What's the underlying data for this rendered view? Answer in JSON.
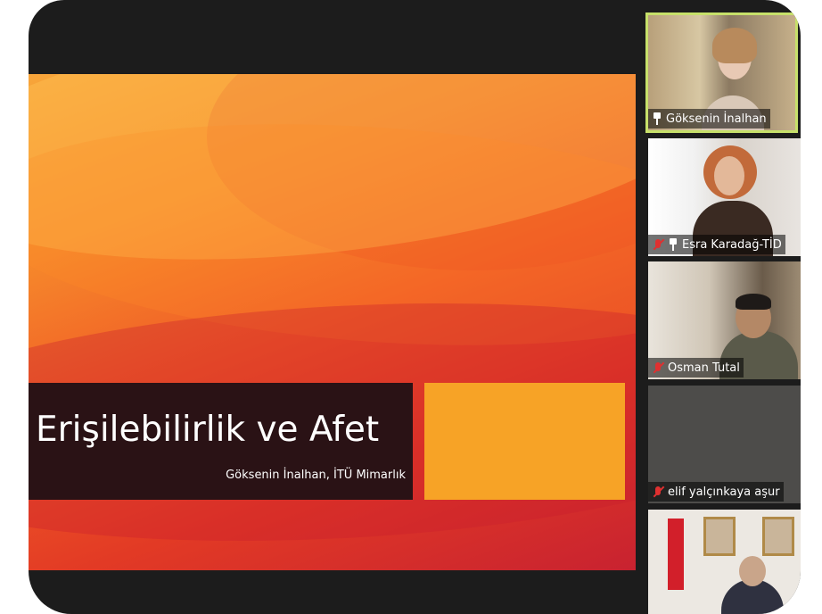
{
  "slide": {
    "title": "Erişilebilirlik ve Afet",
    "subtitle": "Göksenin İnalhan, İTÜ Mimarlık"
  },
  "participants": [
    {
      "name": "Göksenin İnalhan",
      "muted": false,
      "pinned": true,
      "active_speaker": true
    },
    {
      "name": "Esra Karadağ-TİD",
      "muted": true,
      "pinned": true,
      "active_speaker": false
    },
    {
      "name": "Osman Tutal",
      "muted": true,
      "pinned": false,
      "active_speaker": false
    },
    {
      "name": "elif yalçınkaya aşur",
      "muted": true,
      "pinned": false,
      "active_speaker": false
    },
    {
      "name": "",
      "muted": false,
      "pinned": false,
      "active_speaker": false
    }
  ],
  "colors": {
    "active_speaker_border": "#c7e06a",
    "slide_title_bg": "#2a1215",
    "slide_accent": "#f7a326",
    "mute_red": "#e03030"
  },
  "icons": {
    "mute": "microphone-muted-icon",
    "pin": "pin-icon"
  }
}
